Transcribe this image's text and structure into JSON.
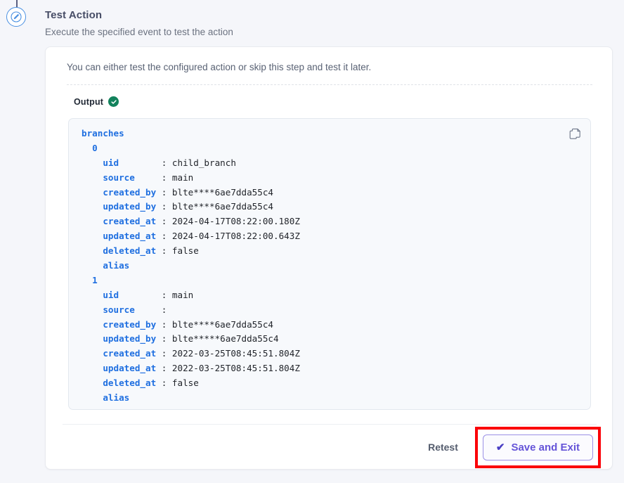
{
  "step": {
    "icon": "pencil-circle-icon",
    "title": "Test Action",
    "subtitle": "Execute the specified event to test the action"
  },
  "card": {
    "intro": "You can either test the configured action or skip this step and test it later.",
    "output": {
      "label": "Output",
      "status_icon": "green-check-circle-icon",
      "copy_icon": "copy-icon"
    }
  },
  "code": {
    "root_key": "branches",
    "items": [
      {
        "index": "0",
        "fields": [
          {
            "key": "uid",
            "value": "child_branch"
          },
          {
            "key": "source",
            "value": "main"
          },
          {
            "key": "created_by",
            "value": "blte****6ae7dda55c4"
          },
          {
            "key": "updated_by",
            "value": "blte****6ae7dda55c4"
          },
          {
            "key": "created_at",
            "value": "2024-04-17T08:22:00.180Z"
          },
          {
            "key": "updated_at",
            "value": "2024-04-17T08:22:00.643Z"
          },
          {
            "key": "deleted_at",
            "value": "false"
          },
          {
            "key": "alias",
            "value": ""
          }
        ]
      },
      {
        "index": "1",
        "fields": [
          {
            "key": "uid",
            "value": "main"
          },
          {
            "key": "source",
            "value": ""
          },
          {
            "key": "created_by",
            "value": "blte****6ae7dda55c4"
          },
          {
            "key": "updated_by",
            "value": "blte*****6ae7dda55c4"
          },
          {
            "key": "created_at",
            "value": "2022-03-25T08:45:51.804Z"
          },
          {
            "key": "updated_at",
            "value": "2022-03-25T08:45:51.804Z"
          },
          {
            "key": "deleted_at",
            "value": "false"
          },
          {
            "key": "alias",
            "value": ""
          }
        ]
      }
    ]
  },
  "footer": {
    "retest_label": "Retest",
    "save_label": "Save and Exit",
    "save_check_glyph": "✔"
  },
  "colors": {
    "page_bg": "#f5f6fa",
    "accent_purple": "#6554d8",
    "highlight_red": "#fb0007",
    "status_green": "#12825c",
    "code_key_blue": "#1f6fe0"
  }
}
